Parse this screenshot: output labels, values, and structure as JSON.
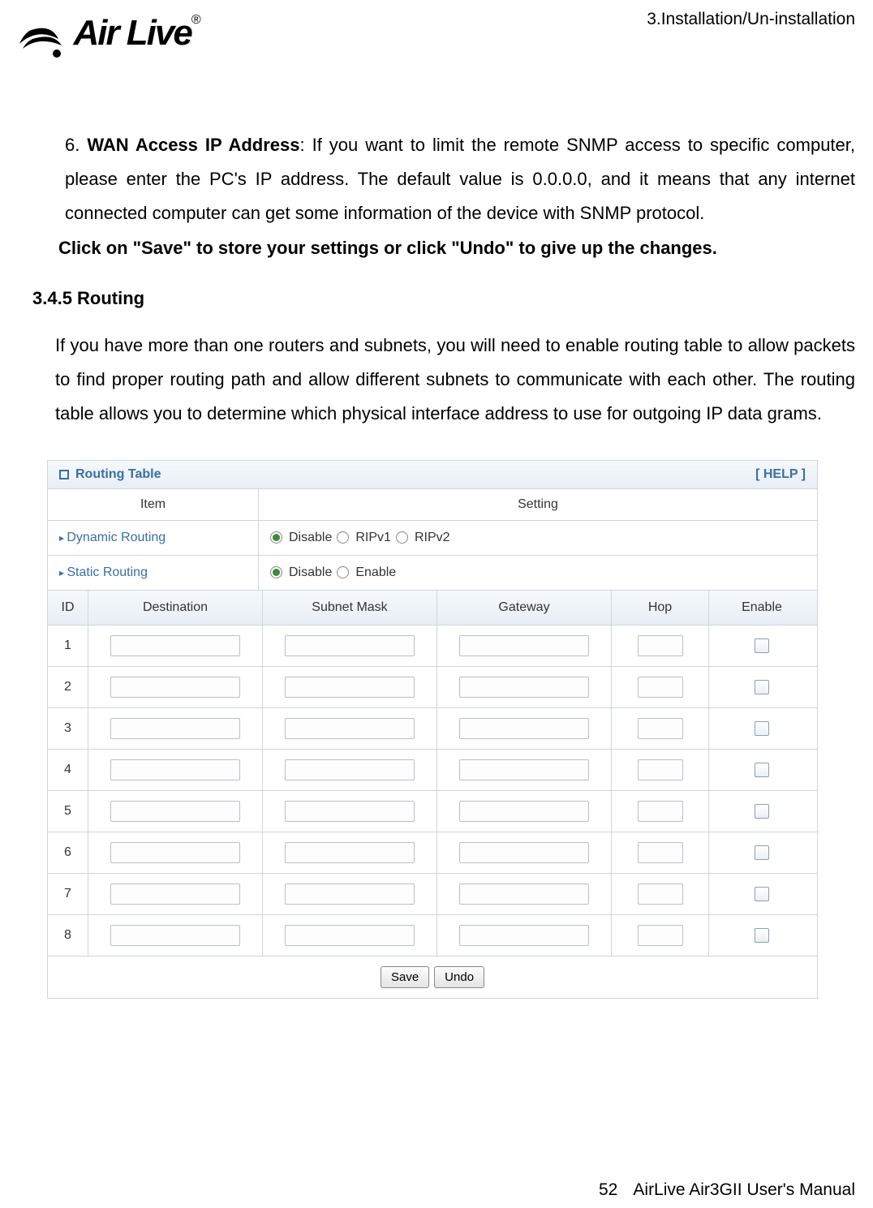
{
  "header": {
    "breadcrumb": "3.Installation/Un-installation"
  },
  "logo": {
    "brand": "Air Live",
    "registered": "®"
  },
  "content": {
    "item6": {
      "number": "6.",
      "title": "WAN Access IP Address",
      "text": ": If you want to limit the remote SNMP access to specific computer, please enter the PC's IP address. The default value is 0.0.0.0, and it means that any internet connected computer can get some information of the device with SNMP protocol."
    },
    "save_note": "Click on \"Save\" to store your settings or click \"Undo\" to give up the changes.",
    "section_heading": "3.4.5 Routing",
    "section_body": "If you have more than one routers and subnets, you will need to enable routing table to allow packets to find proper routing path and allow different subnets to communicate with each other. The routing table allows you to determine which physical interface address to use for outgoing IP data grams."
  },
  "figure": {
    "title": "Routing Table",
    "help": "[ HELP ]",
    "header_row": {
      "item": "Item",
      "setting": "Setting"
    },
    "dynamic": {
      "label": "Dynamic Routing",
      "options": [
        "Disable",
        "RIPv1",
        "RIPv2"
      ],
      "selected": "Disable"
    },
    "static": {
      "label": "Static Routing",
      "options": [
        "Disable",
        "Enable"
      ],
      "selected": "Disable"
    },
    "columns": {
      "id": "ID",
      "destination": "Destination",
      "subnet": "Subnet Mask",
      "gateway": "Gateway",
      "hop": "Hop",
      "enable": "Enable"
    },
    "rows": [
      {
        "id": "1",
        "destination": "",
        "subnet": "",
        "gateway": "",
        "hop": "",
        "enable": false
      },
      {
        "id": "2",
        "destination": "",
        "subnet": "",
        "gateway": "",
        "hop": "",
        "enable": false
      },
      {
        "id": "3",
        "destination": "",
        "subnet": "",
        "gateway": "",
        "hop": "",
        "enable": false
      },
      {
        "id": "4",
        "destination": "",
        "subnet": "",
        "gateway": "",
        "hop": "",
        "enable": false
      },
      {
        "id": "5",
        "destination": "",
        "subnet": "",
        "gateway": "",
        "hop": "",
        "enable": false
      },
      {
        "id": "6",
        "destination": "",
        "subnet": "",
        "gateway": "",
        "hop": "",
        "enable": false
      },
      {
        "id": "7",
        "destination": "",
        "subnet": "",
        "gateway": "",
        "hop": "",
        "enable": false
      },
      {
        "id": "8",
        "destination": "",
        "subnet": "",
        "gateway": "",
        "hop": "",
        "enable": false
      }
    ],
    "buttons": {
      "save": "Save",
      "undo": "Undo"
    }
  },
  "footer": {
    "page_number": "52",
    "manual": "AirLive Air3GII User's Manual"
  }
}
